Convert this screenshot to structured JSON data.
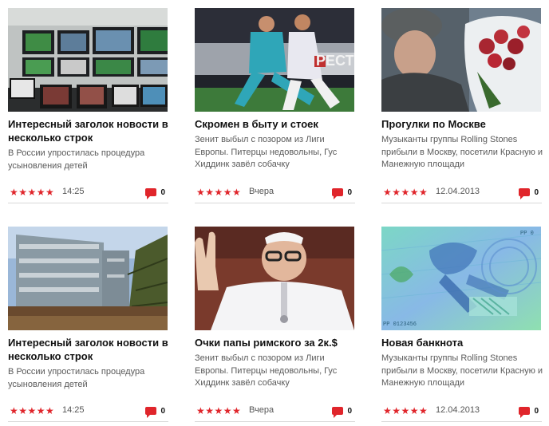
{
  "colors": {
    "accent": "#e0252b",
    "title": "#111111",
    "desc": "#5a5a5a",
    "divider": "#d9d9d9"
  },
  "icons": {
    "rating": "star-icon",
    "comments": "comment-bubble-icon"
  },
  "cards": [
    {
      "title": "Интересный заголок новости в несколько строк",
      "desc": "В России упростилась процедура усыновления детей",
      "image": "tv-monitors-photo",
      "rating": 5,
      "stars": "★★★★★",
      "date": "14:25",
      "comments": "0"
    },
    {
      "title": "Скромен в быту и стоек",
      "desc": "Зенит выбыл с позором из Лиги Европы. Питерцы недовольны, Гус Хиддинк завёл собачку",
      "image": "football-match-photo",
      "rating": 5,
      "stars": "★★★★★",
      "date": "Вчера",
      "comments": "0"
    },
    {
      "title": "Прогулки по Москве",
      "desc": "Музыканты группы Rolling Stones прибыли в Москву, посетили Красную и Манежную площади",
      "image": "man-with-flowers-photo",
      "rating": 5,
      "stars": "★★★★★",
      "date": "12.04.2013",
      "comments": "0"
    },
    {
      "title": "Интересный заголок новости в несколько строк",
      "desc": "В России упростилась процедура усыновления детей",
      "image": "glass-building-photo",
      "rating": 5,
      "stars": "★★★★★",
      "date": "14:25",
      "comments": "0"
    },
    {
      "title": "Очки папы римского за 2к.$",
      "desc": "Зенит выбыл с позором из Лиги Европы. Питерцы недовольны, Гус Хиддинк завёл собачку",
      "image": "pope-photo",
      "rating": 5,
      "stars": "★★★★★",
      "date": "Вчера",
      "comments": "0"
    },
    {
      "title": "Новая банкнота",
      "desc": "Музыканты группы Rolling Stones прибыли в Москву, посетили Красную и Манежную площади",
      "image": "banknote-photo",
      "rating": 5,
      "stars": "★★★★★",
      "date": "12.04.2013",
      "comments": "0"
    }
  ]
}
